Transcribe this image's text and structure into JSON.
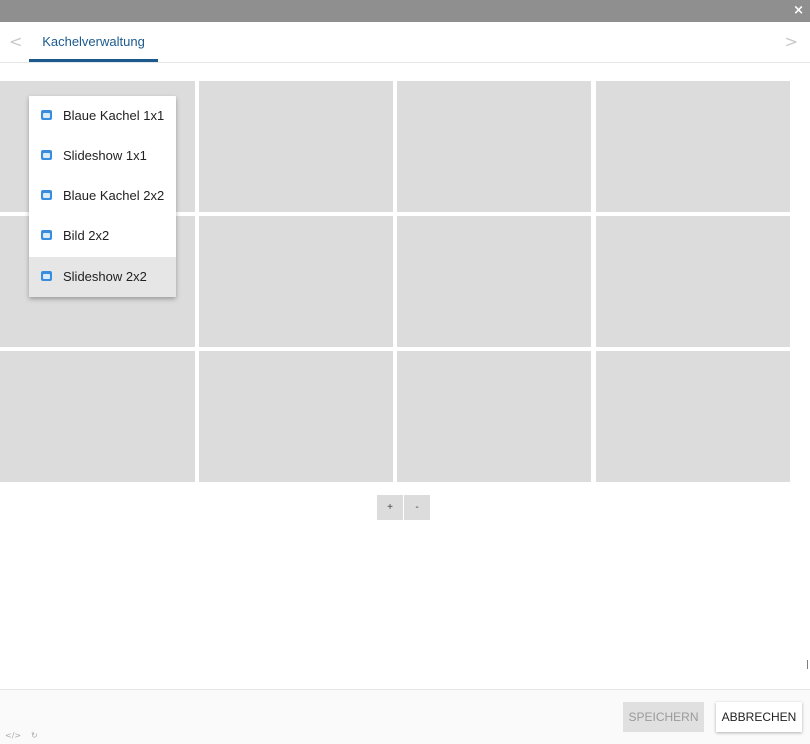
{
  "window": {
    "close_glyph": "×"
  },
  "tabs": {
    "prev_glyph": "<",
    "next_glyph": ">",
    "items": [
      {
        "label": "Kachelverwaltung",
        "active": true
      }
    ]
  },
  "grid": {
    "rows": 3,
    "columns": 4,
    "cell_color": "#dcdcdc"
  },
  "context_menu": {
    "items": [
      {
        "label": "Blaue Kachel 1x1",
        "icon": "tile-icon"
      },
      {
        "label": "Slideshow 1x1",
        "icon": "tile-icon"
      },
      {
        "label": "Blaue Kachel 2x2",
        "icon": "tile-icon"
      },
      {
        "label": "Bild 2x2",
        "icon": "tile-icon"
      },
      {
        "label": "Slideshow 2x2",
        "icon": "tile-icon",
        "hovered": true
      }
    ]
  },
  "grid_controls": {
    "add_label": "+",
    "remove_label": "-"
  },
  "footer": {
    "save_label": "SPEICHERN",
    "cancel_label": "ABBRECHEN"
  },
  "status_icons": {
    "code_glyph": "</>",
    "refresh_glyph": "↻"
  },
  "colors": {
    "accent": "#1c5a8e",
    "tile_icon": "#3a8dde"
  }
}
